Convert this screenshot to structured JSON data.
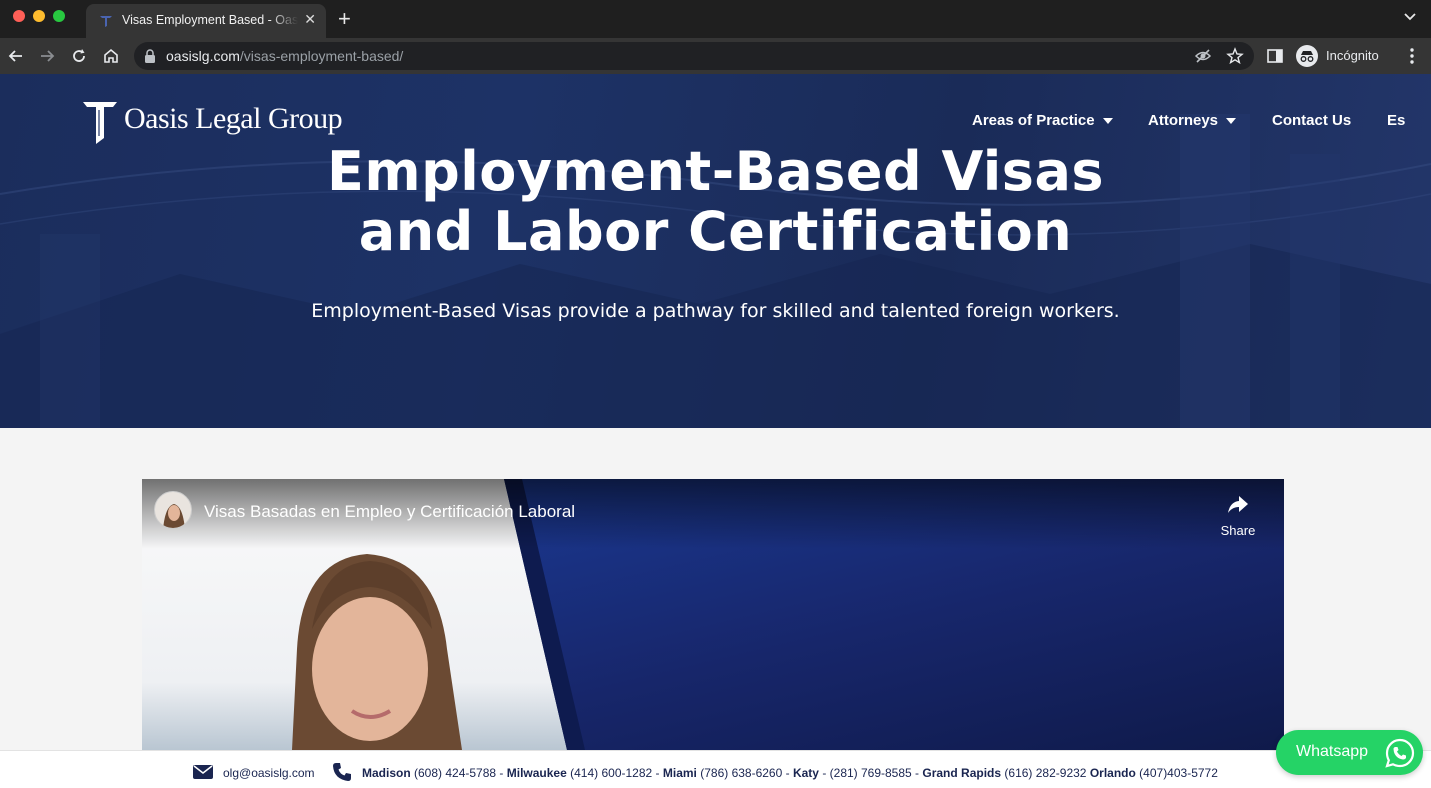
{
  "browser": {
    "tab_title": "Visas Employment Based - Oasis Legal Group",
    "new_tab": "+",
    "tab_close": "✕",
    "url_domain": "oasislg.com",
    "url_path": "/visas-employment-based/",
    "profile_label": "Incógnito"
  },
  "header": {
    "logo_text": "Oasis Legal Group",
    "nav": {
      "areas": "Areas of Practice",
      "attorneys": "Attorneys",
      "contact": "Contact Us",
      "lang": "Es"
    }
  },
  "hero": {
    "title_line1": "Employment-Based Visas",
    "title_line2": "and Labor Certification",
    "subtitle": "Employment-Based Visas provide a pathway for skilled and talented foreign workers."
  },
  "video": {
    "title": "Visas Basadas en Empleo y Certificación Laboral",
    "share_label": "Share"
  },
  "contact_bar": {
    "email": "olg@oasislg.com",
    "offices": [
      {
        "city": "Madison",
        "phone": "(608) 424-5788",
        "sep": " - "
      },
      {
        "city": "Milwaukee",
        "phone": "(414) 600-1282",
        "sep": " - "
      },
      {
        "city": "Miami",
        "phone": "(786) 638-6260",
        "sep": " - "
      },
      {
        "city": "Katy",
        "phone": "- (281) 769-8585",
        "sep": " - "
      },
      {
        "city": "Grand Rapids",
        "phone": "(616) 282-9232",
        "sep": " "
      },
      {
        "city": "Orlando",
        "phone": "(407)403-5772",
        "sep": ""
      }
    ]
  },
  "whatsapp": {
    "label": "Whatsapp"
  },
  "colors": {
    "hero_navy": "#1d3266",
    "whatsapp_green": "#25d366",
    "contact_text": "#1a2550"
  }
}
